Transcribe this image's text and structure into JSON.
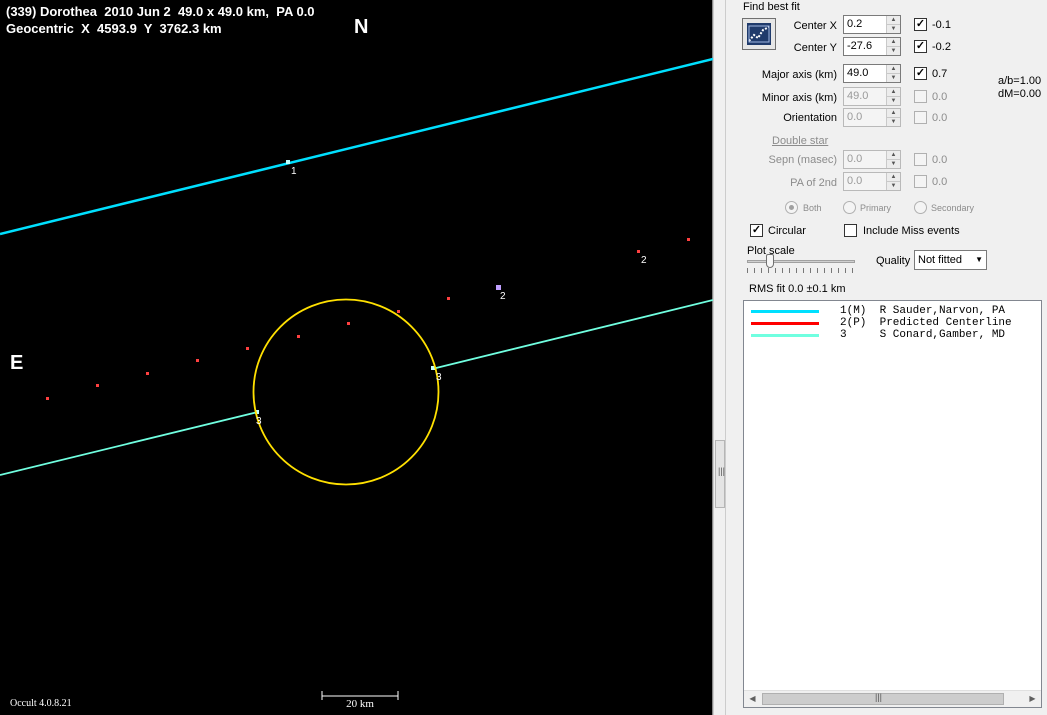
{
  "plot": {
    "title_line1": "(339) Dorothea  2010 Jun 2  49.0 x 49.0 km,  PA 0.0",
    "title_line2": "Geocentric  X  4593.9  Y  3762.3 km",
    "north_label": "N",
    "east_label": "E",
    "version": "Occult 4.0.8.21",
    "scale_bar_label": "20 km",
    "chord_labels": {
      "chord1": "1",
      "chord2a": "2",
      "chord2b": "2",
      "chord3a": "3",
      "chord3b": "3"
    },
    "colors": {
      "chord1": "#00e0ff",
      "chord3": "#70ffe0",
      "ellipse": "#ffe000",
      "predicted_points": "#ff4040",
      "background": "#000000"
    }
  },
  "panel": {
    "section_title": "Find best fit",
    "fit_button_icon": "best-fit-chart-icon",
    "center_x": {
      "label": "Center X",
      "value": "0.2",
      "checked": "✓",
      "offset": "-0.1"
    },
    "center_y": {
      "label": "Center Y",
      "value": "-27.6",
      "checked": "✓",
      "offset": "-0.2"
    },
    "major_axis": {
      "label": "Major axis (km)",
      "value": "49.0",
      "checked": "✓",
      "offset": "0.7"
    },
    "minor_axis": {
      "label": "Minor axis (km)",
      "value": "49.0",
      "offset": "0.0"
    },
    "orientation": {
      "label": "Orientation",
      "value": "0.0",
      "offset": "0.0"
    },
    "ratio": "a/b=1.00",
    "dm": "dM=0.00",
    "double_star": "Double star",
    "sepn": {
      "label": "Sepn (masec)",
      "value": "0.0",
      "offset": "0.0"
    },
    "pa_2nd": {
      "label": "PA of 2nd",
      "value": "0.0",
      "offset": "0.0"
    },
    "radio_both": "Both",
    "radio_primary": "Primary",
    "radio_secondary": "Secondary",
    "circular": {
      "label": "Circular",
      "checked": "✓"
    },
    "include_miss": {
      "label": "Include Miss events"
    },
    "plot_scale_label": "Plot scale",
    "quality_label": "Quality",
    "quality_value": "Not fitted",
    "rms_fit": "RMS fit 0.0 ±0.1 km"
  },
  "legend": {
    "rows": [
      {
        "text": "1(M)  R Sauder,Narvon, PA",
        "color": "#00e0ff"
      },
      {
        "text": "2(P)  Predicted Centerline",
        "color": "#ff0000"
      },
      {
        "text": "3     S Conard,Gamber, MD",
        "color": "#70ffe0"
      }
    ]
  }
}
